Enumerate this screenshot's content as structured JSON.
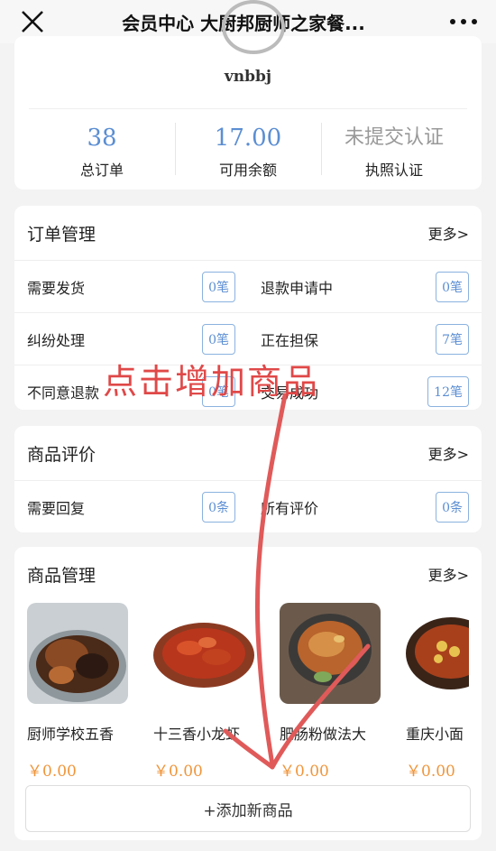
{
  "header": {
    "title": "会员中心 大厨邦厨师之家餐..."
  },
  "profile": {
    "username": "vnbbj",
    "stats": [
      {
        "value": "38",
        "label": "总订单"
      },
      {
        "value": "17.00",
        "label": "可用余额"
      },
      {
        "value": "未提交认证",
        "label": "执照认证"
      }
    ]
  },
  "orders": {
    "title": "订单管理",
    "more": "更多>",
    "items": [
      {
        "label": "需要发货",
        "count": "0笔"
      },
      {
        "label": "退款申请中",
        "count": "0笔"
      },
      {
        "label": "纠纷处理",
        "count": "0笔"
      },
      {
        "label": "正在担保",
        "count": "7笔"
      },
      {
        "label": "不同意退款",
        "count": "0笔"
      },
      {
        "label": "交易成功",
        "count": "12笔"
      }
    ]
  },
  "reviews": {
    "title": "商品评价",
    "more": "更多>",
    "items": [
      {
        "label": "需要回复",
        "count": "0条"
      },
      {
        "label": "所有评价",
        "count": "0条"
      }
    ]
  },
  "products": {
    "title": "商品管理",
    "more": "更多>",
    "items": [
      {
        "name": "厨师学校五香",
        "price": "￥0.00"
      },
      {
        "name": "十三香小龙虾",
        "price": "￥0.00"
      },
      {
        "name": "肥肠粉做法大",
        "price": "￥0.00"
      },
      {
        "name": "重庆小面",
        "price": "￥0.00"
      }
    ],
    "add_label": "+添加新商品"
  },
  "annotation": {
    "text": "点击增加商品",
    "color": "#e04848"
  },
  "colors": {
    "accent_blue": "#5b8ed3",
    "price_orange": "#f0953a"
  },
  "icons": [
    "close-icon",
    "more-dots-icon"
  ]
}
